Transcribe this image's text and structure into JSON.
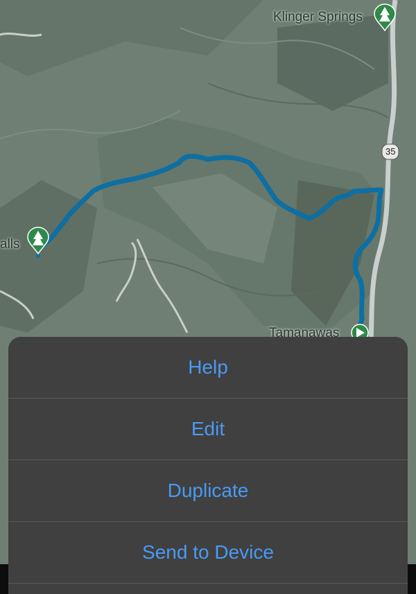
{
  "map": {
    "labels": {
      "klinger_springs": "Klinger Springs",
      "falls_partial": "alls",
      "tamanawas_partial": "Tamanawas",
      "highway_35": "35"
    },
    "icons": {
      "poi_left": "tree-icon",
      "poi_top_right": "tree-icon",
      "trailhead": "play-icon"
    },
    "colors": {
      "terrain": "#6f7f74",
      "route": "#0d6fa3",
      "poi": "#2f8a4a",
      "road": "#c9cfcc"
    }
  },
  "action_sheet": {
    "items": [
      {
        "label": "Help"
      },
      {
        "label": "Edit"
      },
      {
        "label": "Duplicate"
      },
      {
        "label": "Send to Device"
      }
    ],
    "accent_color": "#4a9af5"
  }
}
